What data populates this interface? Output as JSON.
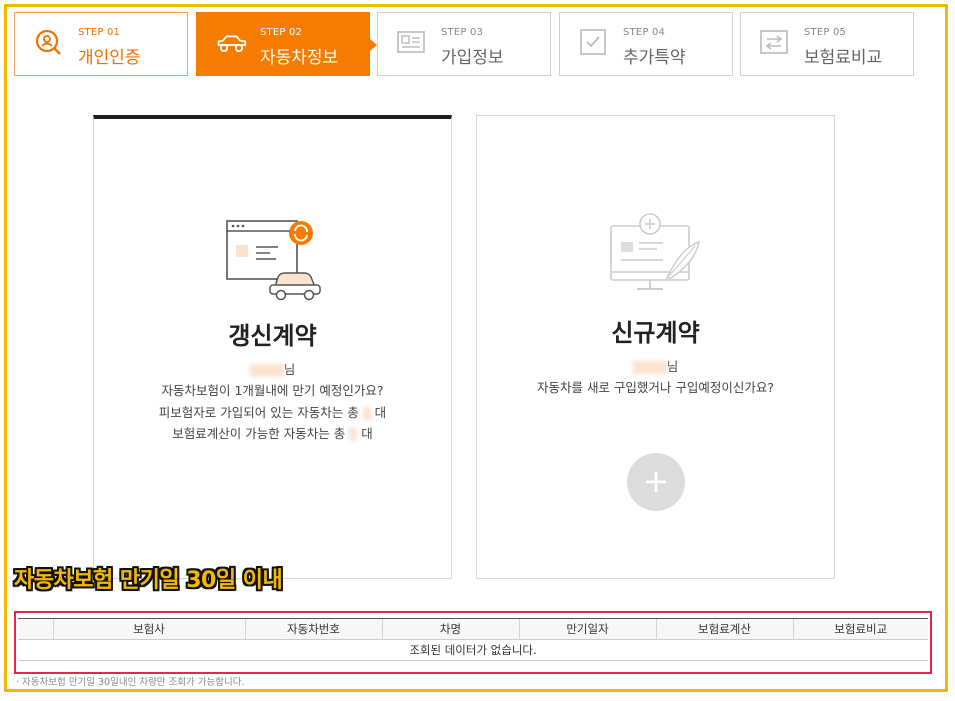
{
  "steps": [
    {
      "num": "STEP 01",
      "name": "개인인증",
      "icon": "user-search-icon",
      "state": "done"
    },
    {
      "num": "STEP 02",
      "name": "자동차정보",
      "icon": "car-icon",
      "state": "active"
    },
    {
      "num": "STEP 03",
      "name": "가입정보",
      "icon": "id-card-icon",
      "state": "pending"
    },
    {
      "num": "STEP 04",
      "name": "추가특약",
      "icon": "checkbox-icon",
      "state": "pending"
    },
    {
      "num": "STEP 05",
      "name": "보험료비교",
      "icon": "compare-icon",
      "state": "pending"
    }
  ],
  "renew": {
    "title": "갱신계약",
    "name_suffix": "님",
    "line1": "자동차보험이 1개월내에 만기 예정인가요?",
    "line2_a": "피보험자로 가입되어 있는 자동차는 총",
    "line2_b": "대",
    "line3_a": "보험료계산이 가능한 자동차는 총",
    "line3_b": "대"
  },
  "newc": {
    "title": "신규계약",
    "name_suffix": "님",
    "line1": "자동차를 새로 구입했거나 구입예정이신가요?",
    "add_symbol": "+"
  },
  "caption": "자동차보험 만기일 30일 이내",
  "table": {
    "headers": [
      "",
      "보험사",
      "자동차번호",
      "차명",
      "만기일자",
      "보험료계산",
      "보험료비교"
    ],
    "empty_message": "조회된 데이터가 없습니다."
  },
  "note": "· 자동차보험 만기일 30일내인 차량만 조회가 가능합니다.",
  "colors": {
    "accent": "#f57c00",
    "frame": "#f5b800",
    "highlight": "#e8244d"
  }
}
